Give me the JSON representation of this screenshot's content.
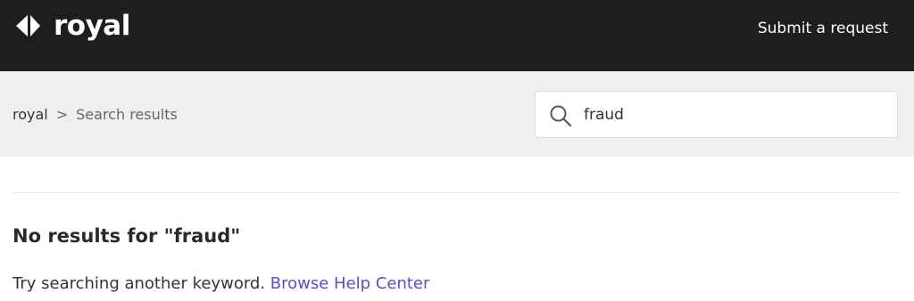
{
  "header": {
    "brand": "royal",
    "submit_request": "Submit a request"
  },
  "breadcrumb": {
    "root": "royal",
    "separator": ">",
    "current": "Search results"
  },
  "search": {
    "value": "fraud",
    "icon": "search-icon"
  },
  "results": {
    "heading": "No results for \"fraud\"",
    "hint": "Try searching another keyword.",
    "browse_link": "Browse Help Center"
  },
  "colors": {
    "header_bg": "#1e1e1e",
    "subbar_bg": "#efefef",
    "link": "#5b4ccf"
  }
}
